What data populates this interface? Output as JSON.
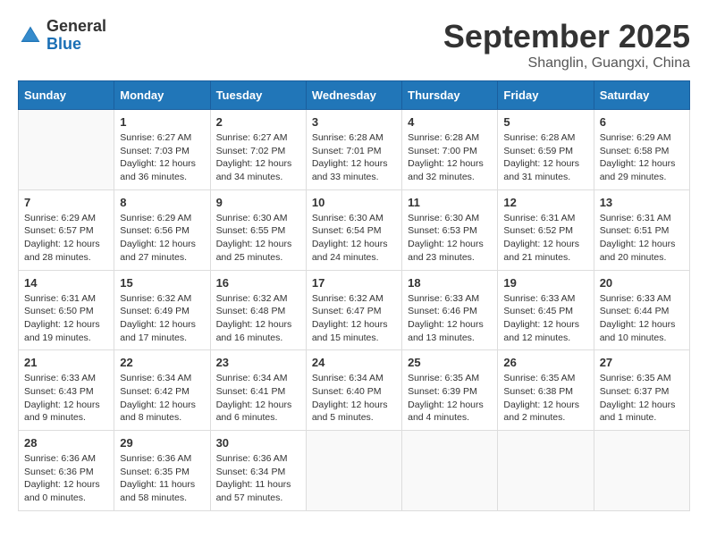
{
  "header": {
    "logo_general": "General",
    "logo_blue": "Blue",
    "month": "September 2025",
    "location": "Shanglin, Guangxi, China"
  },
  "days_of_week": [
    "Sunday",
    "Monday",
    "Tuesday",
    "Wednesday",
    "Thursday",
    "Friday",
    "Saturday"
  ],
  "weeks": [
    [
      {
        "day": "",
        "content": ""
      },
      {
        "day": "1",
        "content": "Sunrise: 6:27 AM\nSunset: 7:03 PM\nDaylight: 12 hours\nand 36 minutes."
      },
      {
        "day": "2",
        "content": "Sunrise: 6:27 AM\nSunset: 7:02 PM\nDaylight: 12 hours\nand 34 minutes."
      },
      {
        "day": "3",
        "content": "Sunrise: 6:28 AM\nSunset: 7:01 PM\nDaylight: 12 hours\nand 33 minutes."
      },
      {
        "day": "4",
        "content": "Sunrise: 6:28 AM\nSunset: 7:00 PM\nDaylight: 12 hours\nand 32 minutes."
      },
      {
        "day": "5",
        "content": "Sunrise: 6:28 AM\nSunset: 6:59 PM\nDaylight: 12 hours\nand 31 minutes."
      },
      {
        "day": "6",
        "content": "Sunrise: 6:29 AM\nSunset: 6:58 PM\nDaylight: 12 hours\nand 29 minutes."
      }
    ],
    [
      {
        "day": "7",
        "content": "Sunrise: 6:29 AM\nSunset: 6:57 PM\nDaylight: 12 hours\nand 28 minutes."
      },
      {
        "day": "8",
        "content": "Sunrise: 6:29 AM\nSunset: 6:56 PM\nDaylight: 12 hours\nand 27 minutes."
      },
      {
        "day": "9",
        "content": "Sunrise: 6:30 AM\nSunset: 6:55 PM\nDaylight: 12 hours\nand 25 minutes."
      },
      {
        "day": "10",
        "content": "Sunrise: 6:30 AM\nSunset: 6:54 PM\nDaylight: 12 hours\nand 24 minutes."
      },
      {
        "day": "11",
        "content": "Sunrise: 6:30 AM\nSunset: 6:53 PM\nDaylight: 12 hours\nand 23 minutes."
      },
      {
        "day": "12",
        "content": "Sunrise: 6:31 AM\nSunset: 6:52 PM\nDaylight: 12 hours\nand 21 minutes."
      },
      {
        "day": "13",
        "content": "Sunrise: 6:31 AM\nSunset: 6:51 PM\nDaylight: 12 hours\nand 20 minutes."
      }
    ],
    [
      {
        "day": "14",
        "content": "Sunrise: 6:31 AM\nSunset: 6:50 PM\nDaylight: 12 hours\nand 19 minutes."
      },
      {
        "day": "15",
        "content": "Sunrise: 6:32 AM\nSunset: 6:49 PM\nDaylight: 12 hours\nand 17 minutes."
      },
      {
        "day": "16",
        "content": "Sunrise: 6:32 AM\nSunset: 6:48 PM\nDaylight: 12 hours\nand 16 minutes."
      },
      {
        "day": "17",
        "content": "Sunrise: 6:32 AM\nSunset: 6:47 PM\nDaylight: 12 hours\nand 15 minutes."
      },
      {
        "day": "18",
        "content": "Sunrise: 6:33 AM\nSunset: 6:46 PM\nDaylight: 12 hours\nand 13 minutes."
      },
      {
        "day": "19",
        "content": "Sunrise: 6:33 AM\nSunset: 6:45 PM\nDaylight: 12 hours\nand 12 minutes."
      },
      {
        "day": "20",
        "content": "Sunrise: 6:33 AM\nSunset: 6:44 PM\nDaylight: 12 hours\nand 10 minutes."
      }
    ],
    [
      {
        "day": "21",
        "content": "Sunrise: 6:33 AM\nSunset: 6:43 PM\nDaylight: 12 hours\nand 9 minutes."
      },
      {
        "day": "22",
        "content": "Sunrise: 6:34 AM\nSunset: 6:42 PM\nDaylight: 12 hours\nand 8 minutes."
      },
      {
        "day": "23",
        "content": "Sunrise: 6:34 AM\nSunset: 6:41 PM\nDaylight: 12 hours\nand 6 minutes."
      },
      {
        "day": "24",
        "content": "Sunrise: 6:34 AM\nSunset: 6:40 PM\nDaylight: 12 hours\nand 5 minutes."
      },
      {
        "day": "25",
        "content": "Sunrise: 6:35 AM\nSunset: 6:39 PM\nDaylight: 12 hours\nand 4 minutes."
      },
      {
        "day": "26",
        "content": "Sunrise: 6:35 AM\nSunset: 6:38 PM\nDaylight: 12 hours\nand 2 minutes."
      },
      {
        "day": "27",
        "content": "Sunrise: 6:35 AM\nSunset: 6:37 PM\nDaylight: 12 hours\nand 1 minute."
      }
    ],
    [
      {
        "day": "28",
        "content": "Sunrise: 6:36 AM\nSunset: 6:36 PM\nDaylight: 12 hours\nand 0 minutes."
      },
      {
        "day": "29",
        "content": "Sunrise: 6:36 AM\nSunset: 6:35 PM\nDaylight: 11 hours\nand 58 minutes."
      },
      {
        "day": "30",
        "content": "Sunrise: 6:36 AM\nSunset: 6:34 PM\nDaylight: 11 hours\nand 57 minutes."
      },
      {
        "day": "",
        "content": ""
      },
      {
        "day": "",
        "content": ""
      },
      {
        "day": "",
        "content": ""
      },
      {
        "day": "",
        "content": ""
      }
    ]
  ]
}
